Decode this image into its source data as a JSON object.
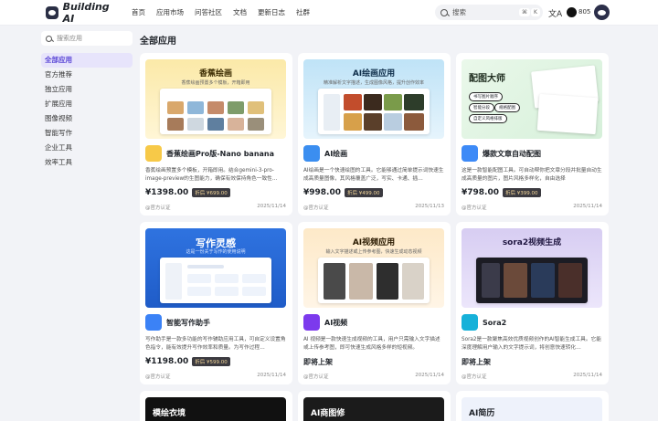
{
  "header": {
    "brand": "Building AI",
    "nav": [
      "首页",
      "应用市场",
      "问答社区",
      "文档",
      "更新日志",
      "社群"
    ],
    "search_placeholder": "搜索",
    "kbd_cmd": "⌘",
    "kbd_k": "K",
    "translate_icon": "文A",
    "github_stars": "805"
  },
  "sidebar": {
    "search_placeholder": "搜索应用",
    "items": [
      "全部应用",
      "官方推荐",
      "独立应用",
      "扩展应用",
      "图像视频",
      "智能写作",
      "企业工具",
      "效率工具"
    ],
    "active_index": 0
  },
  "main": {
    "title": "全部应用",
    "cards": [
      {
        "banner_title": "香蕉绘画",
        "banner_sub": "香蕉绘画预置多个模板，开箱即用",
        "name": "香蕉绘画Pro版-Nano banana",
        "desc": "香蕉绘画预置多个模板，开箱即用。结合gemini-3-pro-image-preview的生图能力，确保有效保持角色一致性…",
        "price": "¥1398.00",
        "discount": "折后 ¥699.00",
        "author": "@官方认证",
        "date": "2025/11/14",
        "colors": {
          "banner": "#fbe9a8",
          "icon": "#f7c948"
        }
      },
      {
        "banner_title": "AI绘画应用",
        "banner_sub": "精准解析文字描述，生成图像风格，提升创作效率",
        "name": "AI绘画",
        "desc": "AI绘画是一个快速绘图的工具。它能够通过简单提示词快速生成高质量图像，其风格覆盖广泛，写实、卡通、插…",
        "price": "¥998.00",
        "discount": "折后 ¥499.00",
        "author": "@官方认证",
        "date": "2025/11/13",
        "colors": {
          "banner": "#bfe3f7",
          "icon": "#3b8ef0"
        }
      },
      {
        "banner_title": "配图大师",
        "banner_sub": "",
        "name": "爆款文章自动配图",
        "desc": "这是一款智能配图工具。可自动帮你把文章分段并批量自动生成高质量的图片，图片风格多样化，自由选择",
        "price": "¥798.00",
        "discount": "折后 ¥399.00",
        "author": "@官方认证",
        "date": "2025/11/14",
        "colors": {
          "banner": "#e4f6e4",
          "icon": "#3d8af7"
        },
        "tags": [
          "书写图片顺序",
          "智能分段",
          "规格配图",
          "自定义风格排版"
        ]
      },
      {
        "banner_title": "写作灵感",
        "banner_sub": "这是一份关于写作的使用说明",
        "name": "智能写作助手",
        "desc": "写作助手是一款多功能的写作辅助应用工具，可自定义设置角色指令，能有效提升写作效率和质量。为写作过程…",
        "price": "¥1198.00",
        "discount": "折后 ¥599.00",
        "author": "@官方认证",
        "date": "2025/11/14",
        "colors": {
          "banner": "#2f73e0",
          "icon": "#3b82f6"
        }
      },
      {
        "banner_title": "AI视频应用",
        "banner_sub": "输入文字描述或上传参考图，快速生成动态视频",
        "name": "AI视频",
        "desc": "AI 视频是一款快速生成视频的工具，用户只需输入文字描述或上传参考图，即可快速生成风格多样的短视频。",
        "soon": "即将上架",
        "author": "@官方认证",
        "date": "2025/11/14",
        "colors": {
          "banner": "#fde9c8",
          "icon": "#7c3aed"
        }
      },
      {
        "banner_title": "sora2视频生成",
        "banner_sub": "",
        "name": "Sora2",
        "desc": "Sora2是一款聚焦高效优质视频创作的AI智能生成工具。它能深度理解用户输入的文字提示词，将创意快速转化…",
        "soon": "即将上架",
        "author": "@官方认证",
        "date": "2025/11/14",
        "colors": {
          "banner": "#d7cdf2",
          "icon": "#16b1d9"
        }
      },
      {
        "banner_title": "模绘衣境",
        "colors": {
          "banner": "#111111"
        }
      },
      {
        "banner_title": "AI商图修",
        "colors": {
          "banner": "#1b1b1b"
        }
      },
      {
        "banner_title": "AI简历",
        "colors": {
          "banner": "#eef2fb"
        }
      }
    ]
  }
}
